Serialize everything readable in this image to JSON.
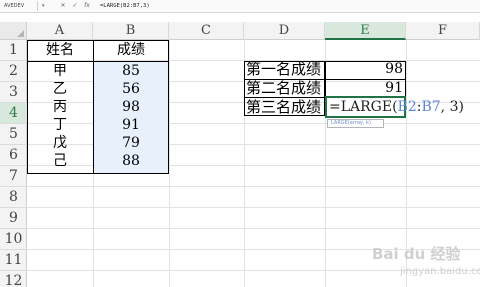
{
  "formula_bar": {
    "name_box": "AVEDEV",
    "caret": "▾",
    "cancel_glyph": "✕",
    "confirm_glyph": "✓",
    "fx_glyph": "fx",
    "formula": "=LARGE(B2:B7,3)"
  },
  "columns": [
    "A",
    "B",
    "C",
    "D",
    "E",
    "F"
  ],
  "rows": [
    "1",
    "2",
    "3",
    "4",
    "5",
    "6",
    "7",
    "8",
    "9",
    "10",
    "11",
    "12"
  ],
  "table": {
    "headers": [
      "姓名",
      "成绩"
    ],
    "rows": [
      {
        "name": "甲",
        "score": "85"
      },
      {
        "name": "乙",
        "score": "56"
      },
      {
        "name": "丙",
        "score": "98"
      },
      {
        "name": "丁",
        "score": "91"
      },
      {
        "name": "戊",
        "score": "79"
      },
      {
        "name": "己",
        "score": "88"
      }
    ]
  },
  "ranking": {
    "first_label": "第一名成绩",
    "first_value": "98",
    "second_label": "第二名成绩",
    "second_value": "91",
    "third_label": "第三名成绩",
    "edit": {
      "prefix": "=LARGE(",
      "ref_start": "B2",
      "colon": ":",
      "ref_end": "B7",
      "suffix": ", 3)"
    },
    "tooltip": "LARGE(array, k)"
  },
  "active": {
    "column": "E",
    "row": "4"
  },
  "colors": {
    "accent": "#217346",
    "selection": "#7b9fe6",
    "reference": "#5b86d6"
  },
  "watermark": {
    "text": "Bai du 经验",
    "sub": "jingyan.baidu.com"
  }
}
